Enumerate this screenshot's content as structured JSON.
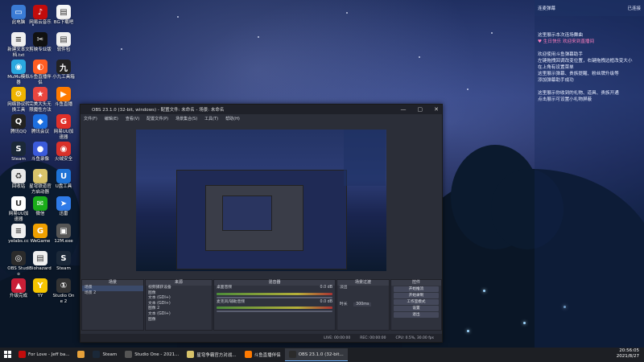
{
  "desktop": {
    "icons": [
      {
        "label": "此电脑",
        "color": "#3a7bd5",
        "glyph": "▭"
      },
      {
        "label": "网易云音乐",
        "color": "#c20c0c",
        "glyph": "♪"
      },
      {
        "label": "BG下载吧",
        "color": "#f5f5f5",
        "glyph": "▤"
      },
      {
        "label": "新建文本文档.txt",
        "color": "#f0f0f0",
        "glyph": "≡"
      },
      {
        "label": "剪映专业版",
        "color": "#111111",
        "glyph": "✂"
      },
      {
        "label": "软件包",
        "color": "#f0f0f0",
        "glyph": "▤"
      },
      {
        "label": "MuMu模拟器",
        "color": "#2aa8e0",
        "glyph": "◉"
      },
      {
        "label": "斗鱼直播伴侣",
        "color": "#ff5d23",
        "glyph": "◐"
      },
      {
        "label": "小九工具箱",
        "color": "#222222",
        "glyph": "九"
      },
      {
        "label": "网络协议转换工具",
        "color": "#f0b400",
        "glyph": "⚙"
      },
      {
        "label": "完美大头无限魔性方法",
        "color": "#e9463f",
        "glyph": "★"
      },
      {
        "label": "斗鱼直播",
        "color": "#ff7a00",
        "glyph": "▶"
      },
      {
        "label": "腾讯QQ",
        "color": "#222222",
        "glyph": "Q"
      },
      {
        "label": "腾讯会议",
        "color": "#1d6fe0",
        "glyph": "◆"
      },
      {
        "label": "网易UU加速器",
        "color": "#e0302a",
        "glyph": "G"
      },
      {
        "label": "Steam",
        "color": "#1b2838",
        "glyph": "S"
      },
      {
        "label": "斗鱼录像",
        "color": "#3b5bdb",
        "glyph": "●"
      },
      {
        "label": "火绒安全",
        "color": "#d9312b",
        "glyph": "◉"
      },
      {
        "label": "回收站",
        "color": "#e8e8e8",
        "glyph": "♻"
      },
      {
        "label": "星穹铁道官方启动器",
        "color": "#d8c36a",
        "glyph": "✦"
      },
      {
        "label": "U盘工具",
        "color": "#1e73d6",
        "glyph": "U"
      },
      {
        "label": "网易UU加速器",
        "color": "#ffffff",
        "glyph": "U"
      },
      {
        "label": "微信",
        "color": "#1aad19",
        "glyph": "✉"
      },
      {
        "label": "迅雷",
        "color": "#2f7be8",
        "glyph": "➤"
      },
      {
        "label": "yelabs.cc",
        "color": "#f0f0f0",
        "glyph": "≡"
      },
      {
        "label": "WeGame",
        "color": "#f0a000",
        "glyph": "G"
      },
      {
        "label": "12M.exe",
        "color": "#555555",
        "glyph": "▣"
      },
      {
        "label": "OBS Studio",
        "color": "#2b2b2b",
        "glyph": "◎"
      },
      {
        "label": "Biohazard",
        "color": "#f0f0f0",
        "glyph": "▤"
      },
      {
        "label": "Steam",
        "color": "#1b2838",
        "glyph": "S"
      },
      {
        "label": "升级完成",
        "color": "#c91f37",
        "glyph": "▲"
      },
      {
        "label": "YY",
        "color": "#f7c600",
        "glyph": "Y"
      },
      {
        "label": "Studio One 2",
        "color": "#333333",
        "glyph": "①"
      }
    ]
  },
  "chat": {
    "header_left": "连麦弹幕",
    "header_right": "已连接",
    "lines": [
      {
        "text": "这里展示本次连场舞曲",
        "hl": false
      },
      {
        "text": "♥ 生日快乐    欢迎来到直播间",
        "hl": true
      },
      {
        "text": "",
        "hl": false
      },
      {
        "text": "欢迎使用斗鱼弹幕助手",
        "hl": false
      },
      {
        "text": "左键拖拽回调改变位置，右键拖拽边框改变大小",
        "hl": false
      },
      {
        "text": "在上角有设置菜单",
        "hl": false
      },
      {
        "text": "这里展示弹幕、贵族提醒、粉丝牌升级等",
        "hl": false
      },
      {
        "text": "添加弹幕助手成功",
        "hl": false
      },
      {
        "text": "",
        "hl": false
      },
      {
        "text": "这里展示你收到的礼物、道具、贵族开通",
        "hl": false
      },
      {
        "text": "点击展示可设置小礼物屏蔽",
        "hl": false
      }
    ]
  },
  "obs": {
    "title": "OBS 23.1.0 (32-bit, windows) - 配置文件: 未命名 - 场景: 未命名",
    "menu": [
      "文件(F)",
      "编辑(E)",
      "查看(V)",
      "配置文件(P)",
      "场景集合(S)",
      "工具(T)",
      "帮助(H)"
    ],
    "docks": {
      "scenes": {
        "title": "场景",
        "items": [
          "场景",
          "场景 2"
        ]
      },
      "sources": {
        "title": "来源",
        "items": [
          "视频捕获设备",
          "图像",
          "文本 (GDI+)",
          "文本 (GDI+)",
          "图像 2",
          "文本 (GDI+)",
          "图像"
        ]
      },
      "mixer": {
        "title": "混音器",
        "channels": [
          {
            "name": "桌面音频",
            "db": "0.0 dB"
          },
          {
            "name": "麦克风/辅助音频",
            "db": "0.0 dB"
          }
        ]
      },
      "transitions": {
        "title": "场景过渡",
        "type": "淡出",
        "duration_label": "时长",
        "duration": "300ms"
      },
      "controls": {
        "title": "控件",
        "buttons": [
          "开始推流",
          "开始录制",
          "工作室模式",
          "设置",
          "退出"
        ]
      }
    },
    "status": {
      "live": "LIVE: 00:00:00",
      "rec": "REC: 00:00:00",
      "cpu": "CPU: 0.5%, 30.00 fps"
    }
  },
  "taskbar": {
    "items": [
      {
        "label": "For Love - Jeff ba...",
        "color": "#c20c0c",
        "active": false
      },
      {
        "label": "",
        "color": "#e8a23a",
        "active": false
      },
      {
        "label": "Steam",
        "color": "#1b2838",
        "active": false
      },
      {
        "label": "Studio One - 2021...",
        "color": "#555555",
        "active": false
      },
      {
        "label": "星穹争霸官方对战...",
        "color": "#d8c36a",
        "active": false
      },
      {
        "label": "斗鱼直播伴侣",
        "color": "#ff7a00",
        "active": false
      },
      {
        "label": "OBS 23.1.0 (32-bit...",
        "color": "#2b2b2b",
        "active": true
      }
    ],
    "time": "20:56:05",
    "date": "2021/8/27"
  },
  "colors": {
    "accent": "#6ab0ff",
    "obs_bg": "#2b2e38",
    "chat_highlight": "#ff7fbf"
  }
}
